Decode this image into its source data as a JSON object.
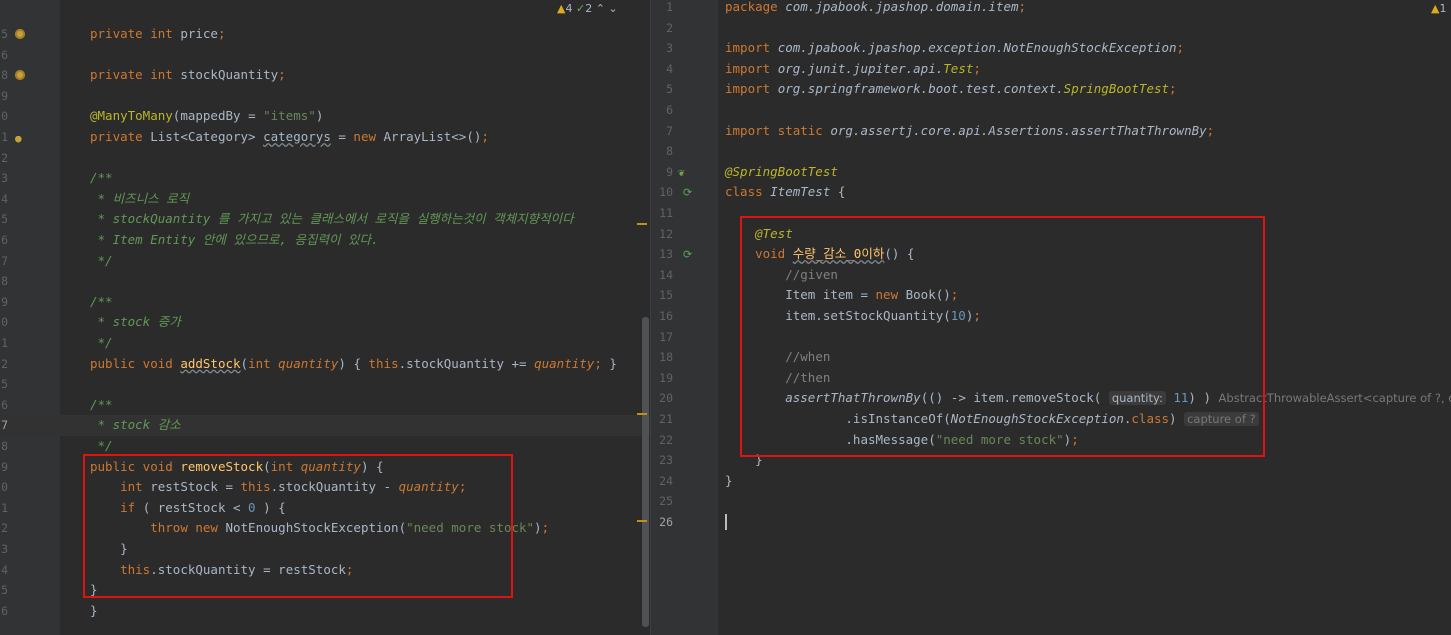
{
  "left_pane": {
    "inspections": {
      "warnings": "4",
      "weak_warnings": "2",
      "up": "⌃",
      "down": "⌄"
    },
    "lines": [
      {
        "num": "5",
        "html": "<span class='k'>private int </span><span class='cls'>price</span><span class='k'>;</span>"
      },
      {
        "num": "6",
        "html": ""
      },
      {
        "num": "8",
        "html": "<span class='k'>private int </span><span class='cls'>stockQuantity</span><span class='k'>;</span>"
      },
      {
        "num": "9",
        "html": ""
      },
      {
        "num": "0",
        "html": "<span class='a'>@ManyToMany</span>(<span class='cls'>mappedBy</span> = <span class='s'>\"items\"</span>)"
      },
      {
        "num": "1",
        "html": "<span class='k'>private </span>List&lt;Category&gt; <span class='u'>categorys</span> = <span class='k'>new </span>ArrayList&lt;&gt;()<span class='k'>;</span>"
      },
      {
        "num": "2",
        "html": ""
      },
      {
        "num": "3",
        "html": "<span class='doc'>/**</span>"
      },
      {
        "num": "4",
        "html": "<span class='doc'> * 비즈니스 로직</span>"
      },
      {
        "num": "5",
        "html": "<span class='doc'> * stockQuantity 를 가지고 있는 클래스에서 로직을 실행하는것이 객체지향적이다</span>"
      },
      {
        "num": "6",
        "html": "<span class='doc'> * Item Entity 안에 있으므로, 응집력이 있다.</span>"
      },
      {
        "num": "7",
        "html": "<span class='doc'> */</span>"
      },
      {
        "num": "8",
        "html": ""
      },
      {
        "num": "9",
        "html": "<span class='doc'>/**</span>"
      },
      {
        "num": "0",
        "html": "<span class='doc'> * stock 증가</span>"
      },
      {
        "num": "1",
        "html": "<span class='doc'> */</span>"
      },
      {
        "num": "2",
        "html": "<span class='k'>public void </span><span class='f u'>addStock</span>(<span class='k'>int </span><span class='par'>quantity</span>) { <span class='k'>this</span>.<span class='cls'>stockQuantity</span> += <span class='par'>quantity</span><span class='k'>;</span> }"
      },
      {
        "num": "5",
        "html": ""
      },
      {
        "num": "6",
        "html": "<span class='doc'>/**</span>"
      },
      {
        "num": "7",
        "html": "<span class='doc'> * stock 감소</span>"
      },
      {
        "num": "8",
        "html": "<span class='doc'> */</span>"
      },
      {
        "num": "9",
        "html": "<span class='k'>public void </span><span class='f'>removeStock</span>(<span class='k'>int </span><span class='par'>quantity</span>) {"
      },
      {
        "num": "0",
        "html": "    <span class='k'>int </span>restStock = <span class='k'>this</span>.<span class='cls'>stockQuantity</span> - <span class='par'>quantity</span><span class='k'>;</span>"
      },
      {
        "num": "1",
        "html": "    <span class='k'>if </span>( restStock &lt; <span class='n'>0</span> ) {"
      },
      {
        "num": "2",
        "html": "        <span class='k'>throw new </span>NotEnoughStockException(<span class='s'>\"need more stock\"</span>)<span class='k'>;</span>"
      },
      {
        "num": "3",
        "html": "    }"
      },
      {
        "num": "4",
        "html": "    <span class='k'>this</span>.<span class='cls'>stockQuantity</span> = restStock<span class='k'>;</span>"
      },
      {
        "num": "5",
        "html": "}"
      },
      {
        "num": "6",
        "html": "}"
      }
    ]
  },
  "right_pane": {
    "inspections": {
      "warnings": "1"
    },
    "lines": [
      {
        "num": "1",
        "html": "<span class='k'>package </span><span class='pkg'>com.jpabook.jpashop.domain.item</span><span class='k'>;</span>"
      },
      {
        "num": "2",
        "html": ""
      },
      {
        "num": "3",
        "html": "<span class='k'>import </span><span class='pkg'>com.jpabook.jpashop.exception.NotEnoughStockException</span><span class='k'>;</span>"
      },
      {
        "num": "4",
        "html": "<span class='k'>import </span><span class='pkg'>org.junit.jupiter.api.</span><span class='a it'>Test</span><span class='k'>;</span>"
      },
      {
        "num": "5",
        "html": "<span class='k'>import </span><span class='pkg'>org.springframework.boot.test.context.</span><span class='a it'>SpringBootTest</span><span class='k'>;</span>"
      },
      {
        "num": "6",
        "html": ""
      },
      {
        "num": "7",
        "html": "<span class='k'>import static </span><span class='pkg'>org.assertj.core.api.Assertions.</span><span class='it'>assertThatThrownBy</span><span class='k'>;</span>"
      },
      {
        "num": "8",
        "html": ""
      },
      {
        "num": "9",
        "html": "<span class='a it'>@SpringBootTest</span>"
      },
      {
        "num": "10",
        "html": "<span class='k'>class </span><span class='it'>ItemTest</span> {"
      },
      {
        "num": "11",
        "html": ""
      },
      {
        "num": "12",
        "html": "    <span class='a it'>@Test</span>"
      },
      {
        "num": "13",
        "html": "    <span class='k'>void </span><span class='f u'>수량_감소_0이하</span>() {"
      },
      {
        "num": "14",
        "html": "        <span class='cmt'>//given</span>"
      },
      {
        "num": "15",
        "html": "        Item item = <span class='k'>new </span>Book()<span class='k'>;</span>"
      },
      {
        "num": "16",
        "html": "        item.setStockQuantity(<span class='n'>10</span>)<span class='k'>;</span>"
      },
      {
        "num": "17",
        "html": ""
      },
      {
        "num": "18",
        "html": "        <span class='cmt'>//when</span>"
      },
      {
        "num": "19",
        "html": "        <span class='cmt'>//then</span>"
      },
      {
        "num": "20",
        "html": "        <span class='it'>assertThatThrownBy</span>(() -&gt; item.removeStock( <span class='hintname'>quantity:</span> <span class='n'>11</span>) ) <span class='grey'>AbstractThrowableAssert&lt;capture of ?, capture</span>"
      },
      {
        "num": "21",
        "html": "                .isInstanceOf(<span class='it'>NotEnoughStockException</span>.<span class='k'>class</span>) <span class='hint'>capture of ?</span>"
      },
      {
        "num": "22",
        "html": "                .hasMessage(<span class='s'>\"need more stock\"</span>)<span class='k'>;</span>"
      },
      {
        "num": "23",
        "html": "    }"
      },
      {
        "num": "24",
        "html": "}"
      },
      {
        "num": "25",
        "html": ""
      },
      {
        "num": "26",
        "html": ""
      }
    ]
  }
}
